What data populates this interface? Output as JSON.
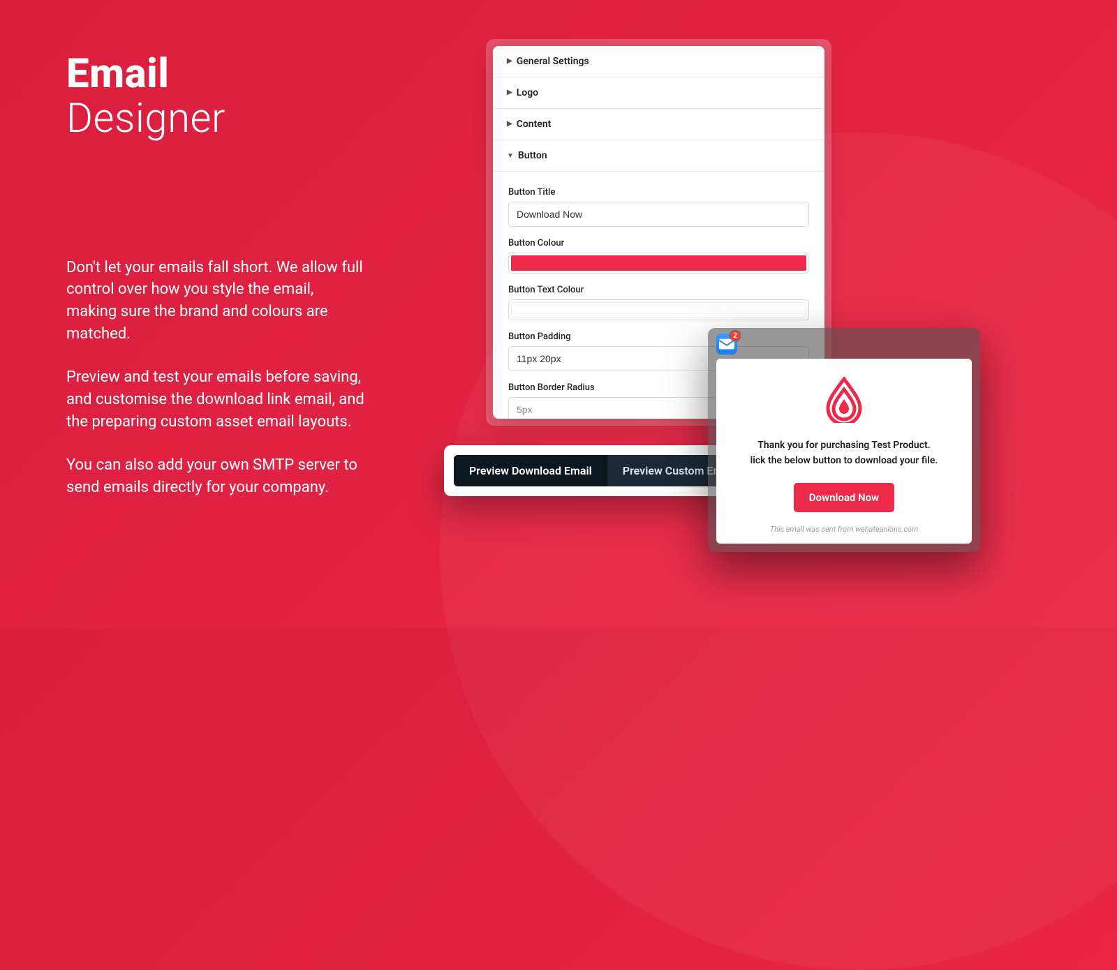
{
  "hero": {
    "title_bold": "Email",
    "title_light": "Designer",
    "para1": "Don't let your emails fall short. We allow full control over how you style the email, making sure the brand and colours are matched.",
    "para2": "Preview and test your emails before saving, and customise the download link email, and the preparing custom asset email layouts.",
    "para3": "You can also add your own SMTP server to send emails directly for your company."
  },
  "panel": {
    "sections": {
      "general": "General Settings",
      "logo": "Logo",
      "content": "Content",
      "button": "Button"
    },
    "fields": {
      "button_title_label": "Button Title",
      "button_title_value": "Download Now",
      "button_colour_label": "Button Colour",
      "button_colour_value": "#ed2a4a",
      "button_text_colour_label": "Button Text Colour",
      "button_text_colour_value": "#ffffff",
      "button_padding_label": "Button Padding",
      "button_padding_value": "11px 20px",
      "button_border_radius_label": "Button Border Radius",
      "button_border_radius_value": "5px"
    }
  },
  "tabs": {
    "download": "Preview Download Email",
    "custom": "Preview Custom Email"
  },
  "email": {
    "badge_count": "2",
    "line1": "Thank you for purchasing Test Product.",
    "line2": "lick the below button to download your file.",
    "button_label": "Download Now",
    "footer": "This email was sent from wehateanions.com"
  }
}
